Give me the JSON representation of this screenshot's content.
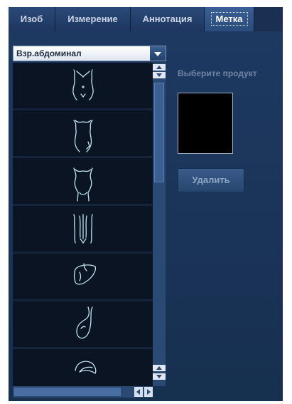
{
  "tabs": [
    {
      "label": "Изоб",
      "active": false
    },
    {
      "label": "Измерение",
      "active": false
    },
    {
      "label": "Аннотация",
      "active": false
    },
    {
      "label": "Метка",
      "active": true
    }
  ],
  "dropdown": {
    "selected": "Взр.абдоминал"
  },
  "list": {
    "items": [
      {
        "icon": "abdomen-front-bodymark-icon"
      },
      {
        "icon": "abdomen-side-bodymark-icon"
      },
      {
        "icon": "lower-abdomen-bodymark-icon"
      },
      {
        "icon": "back-spine-bodymark-icon"
      },
      {
        "icon": "liver-bodymark-icon"
      },
      {
        "icon": "gallbladder-bodymark-icon"
      },
      {
        "icon": "kidney-bodymark-icon"
      }
    ]
  },
  "right_panel": {
    "product_label": "Выберите продукт",
    "delete_label": "Удалить"
  },
  "colors": {
    "panel": "#1e3a62",
    "list_bg": "#0a1422",
    "stroke": "#bfe3ef",
    "active_tab": "#3a5f94"
  }
}
